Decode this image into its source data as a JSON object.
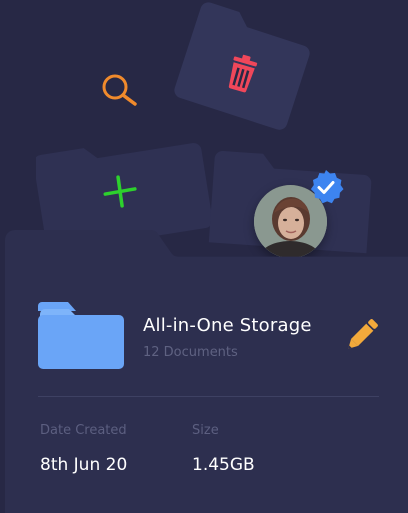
{
  "colors": {
    "background": "#272845",
    "card": "#2d2f4f",
    "folder_accent": "#6aa5f7",
    "search_icon": "#f08a2c",
    "trash_icon": "#f0475a",
    "add_icon": "#2dd12d",
    "edit_icon": "#f2a93b",
    "verified_badge": "#3d84f0"
  },
  "icons": {
    "search": "search-icon",
    "trash": "trash-icon",
    "add": "plus-icon",
    "edit": "pencil-icon",
    "verified": "verified-check-icon",
    "folder": "folder-icon"
  },
  "storage": {
    "title": "All-in-One Storage",
    "document_count": "12 Documents",
    "date_label": "Date Created",
    "date_value": "8th Jun 20",
    "size_label": "Size",
    "size_value": "1.45GB"
  }
}
